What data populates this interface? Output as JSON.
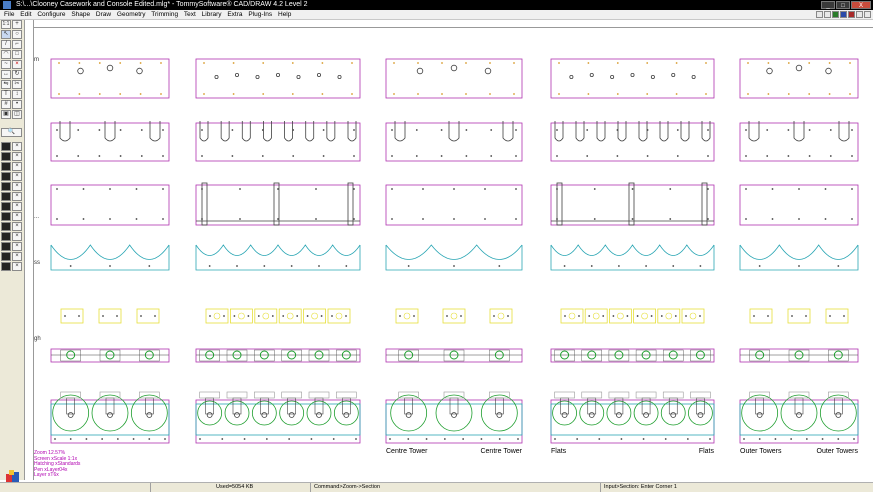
{
  "window": {
    "title": "S:\\...\\Clooney Casework and Console Edited.mlg* - TommySoftware® CAD/DRAW 4.2 Level 2",
    "controls": [
      "_",
      "□",
      "X"
    ]
  },
  "menu": {
    "items": [
      "File",
      "Edit",
      "Configure",
      "Shape",
      "Draw",
      "Geometry",
      "Trimming",
      "Text",
      "Library",
      "Extra",
      "Plug-Ins",
      "Help"
    ]
  },
  "toolbar": {
    "scale_label": "1:1",
    "unit_label": "m"
  },
  "side_labels": [
    "m",
    "...",
    "ss",
    "gh"
  ],
  "drawing": {
    "captions": [
      {
        "text": "Centre Tower"
      },
      {
        "text": "Centre Tower"
      },
      {
        "text": "Flats"
      },
      {
        "text": "Flats"
      },
      {
        "text": "Outer Towers"
      },
      {
        "text": "Outer Towers"
      }
    ],
    "colors": {
      "magenta": "#b032b0",
      "cyan": "#2aa6b4",
      "yellow": "#e6df3a",
      "green": "#1e9e2e",
      "dark": "#404040",
      "orange": "#d79a2a"
    }
  },
  "info_panel": {
    "lines": [
      "Zoom 12.57%",
      "Screen xScale 1:1x",
      "Hatching xStandards",
      "Pen xLayer04x",
      "Layer xT6x"
    ]
  },
  "statusbar": {
    "used": "Used=5054 KB",
    "command": "Command>Zoom->Section",
    "input": "Input>Section: Enter Corner 1"
  }
}
